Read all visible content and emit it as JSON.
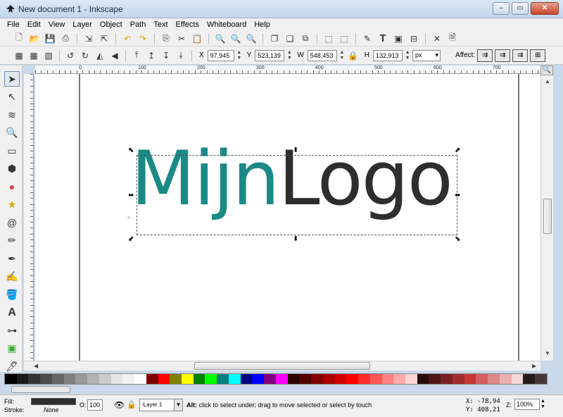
{
  "window": {
    "title": "New document 1 - Inkscape",
    "controls": [
      "–",
      "▭",
      "✕"
    ]
  },
  "menu": [
    "File",
    "Edit",
    "View",
    "Layer",
    "Object",
    "Path",
    "Text",
    "Effects",
    "Whiteboard",
    "Help"
  ],
  "commands_bar": {
    "icons": [
      "new-icon",
      "open-icon",
      "save-icon",
      "print-icon",
      "import-icon",
      "export-icon",
      "undo-icon",
      "redo-icon",
      "copy-icon",
      "cut-icon",
      "paste-icon",
      "zoom-selection-icon",
      "zoom-drawing-icon",
      "zoom-page-icon",
      "duplicate-icon",
      "clone-icon",
      "unlink-icon",
      "group-icon",
      "ungroup-icon",
      "fill-stroke-icon",
      "text-font-icon",
      "xml-editor-icon",
      "align-icon",
      "preferences-icon",
      "document-properties-icon"
    ]
  },
  "controls_bar": {
    "x_label": "X",
    "x_value": "97,945",
    "y_label": "Y",
    "y_value": "523,139",
    "w_label": "W",
    "w_value": "548,453",
    "h_label": "H",
    "h_value": "132,913",
    "unit": "px",
    "affect_label": "Affect:"
  },
  "ruler": {
    "labels": [
      "0",
      "100",
      "200",
      "300",
      "400",
      "500",
      "600",
      "700"
    ]
  },
  "canvas": {
    "logo_part1": "Mijn",
    "logo_part2": "Logo",
    "colors": {
      "teal": "#1b8a86",
      "dark": "#2e2e2e"
    }
  },
  "palette": [
    "#000000",
    "#1a1a1a",
    "#333333",
    "#4d4d4d",
    "#666666",
    "#808080",
    "#999999",
    "#b3b3b3",
    "#cccccc",
    "#e6e6e6",
    "#f2f2f2",
    "#ffffff",
    "#800000",
    "#ff0000",
    "#808000",
    "#ffff00",
    "#008000",
    "#00ff00",
    "#008080",
    "#00ffff",
    "#000080",
    "#0000ff",
    "#800080",
    "#ff00ff",
    "#2b0000",
    "#550000",
    "#800000",
    "#aa0000",
    "#d40000",
    "#ff0000",
    "#ff2a2a",
    "#ff5555",
    "#ff8080",
    "#ffaaaa",
    "#ffd5d5",
    "#280b0b",
    "#501616",
    "#782121",
    "#a02c2c",
    "#c83737",
    "#d35f5f",
    "#de8787",
    "#e9afaf",
    "#f4d7d7",
    "#241c1c",
    "#483737"
  ],
  "status": {
    "fill_label": "Fill:",
    "stroke_label": "Stroke:",
    "stroke_value": "None",
    "opacity_label": "O:",
    "opacity_value": "100",
    "layer": "-Layer 1",
    "message_bold": "Alt:",
    "message": " click to select under; drag to move selected or select by touch",
    "x_coord": "X: -78,94",
    "y_coord": "Y: 408,21",
    "zoom_label": "Z:",
    "zoom_value": "100%"
  }
}
